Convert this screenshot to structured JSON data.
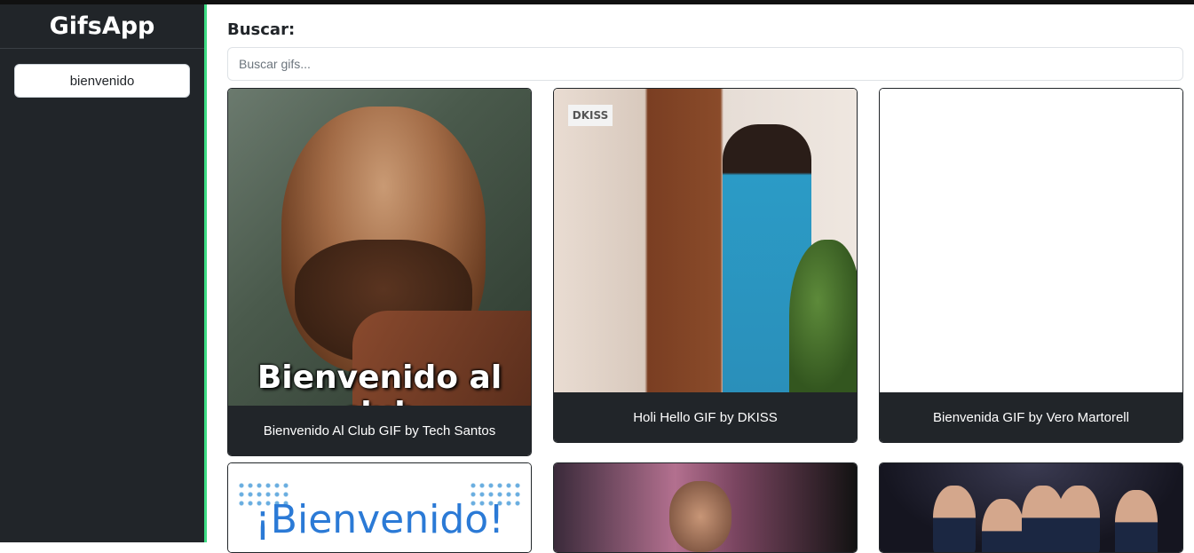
{
  "app": {
    "title": "GifsApp"
  },
  "sidebar": {
    "history": [
      {
        "label": "bienvenido"
      }
    ]
  },
  "search": {
    "label": "Buscar:",
    "placeholder": "Buscar gifs...",
    "value": ""
  },
  "gifs": [
    {
      "title": "Bienvenido Al Club GIF by Tech Santos",
      "overlay_text": "Bienvenido al club"
    },
    {
      "title": "Holi Hello GIF by DKISS",
      "overlay_text": "DKISS"
    },
    {
      "title": "Bienvenida GIF by Vero Martorell"
    },
    {
      "title": "",
      "overlay_text": "¡Bienvenido!"
    },
    {
      "title": ""
    },
    {
      "title": ""
    }
  ],
  "colors": {
    "sidebar_bg": "#212529",
    "accent_divider": "#3ddc84",
    "caption_bg": "#212529"
  }
}
